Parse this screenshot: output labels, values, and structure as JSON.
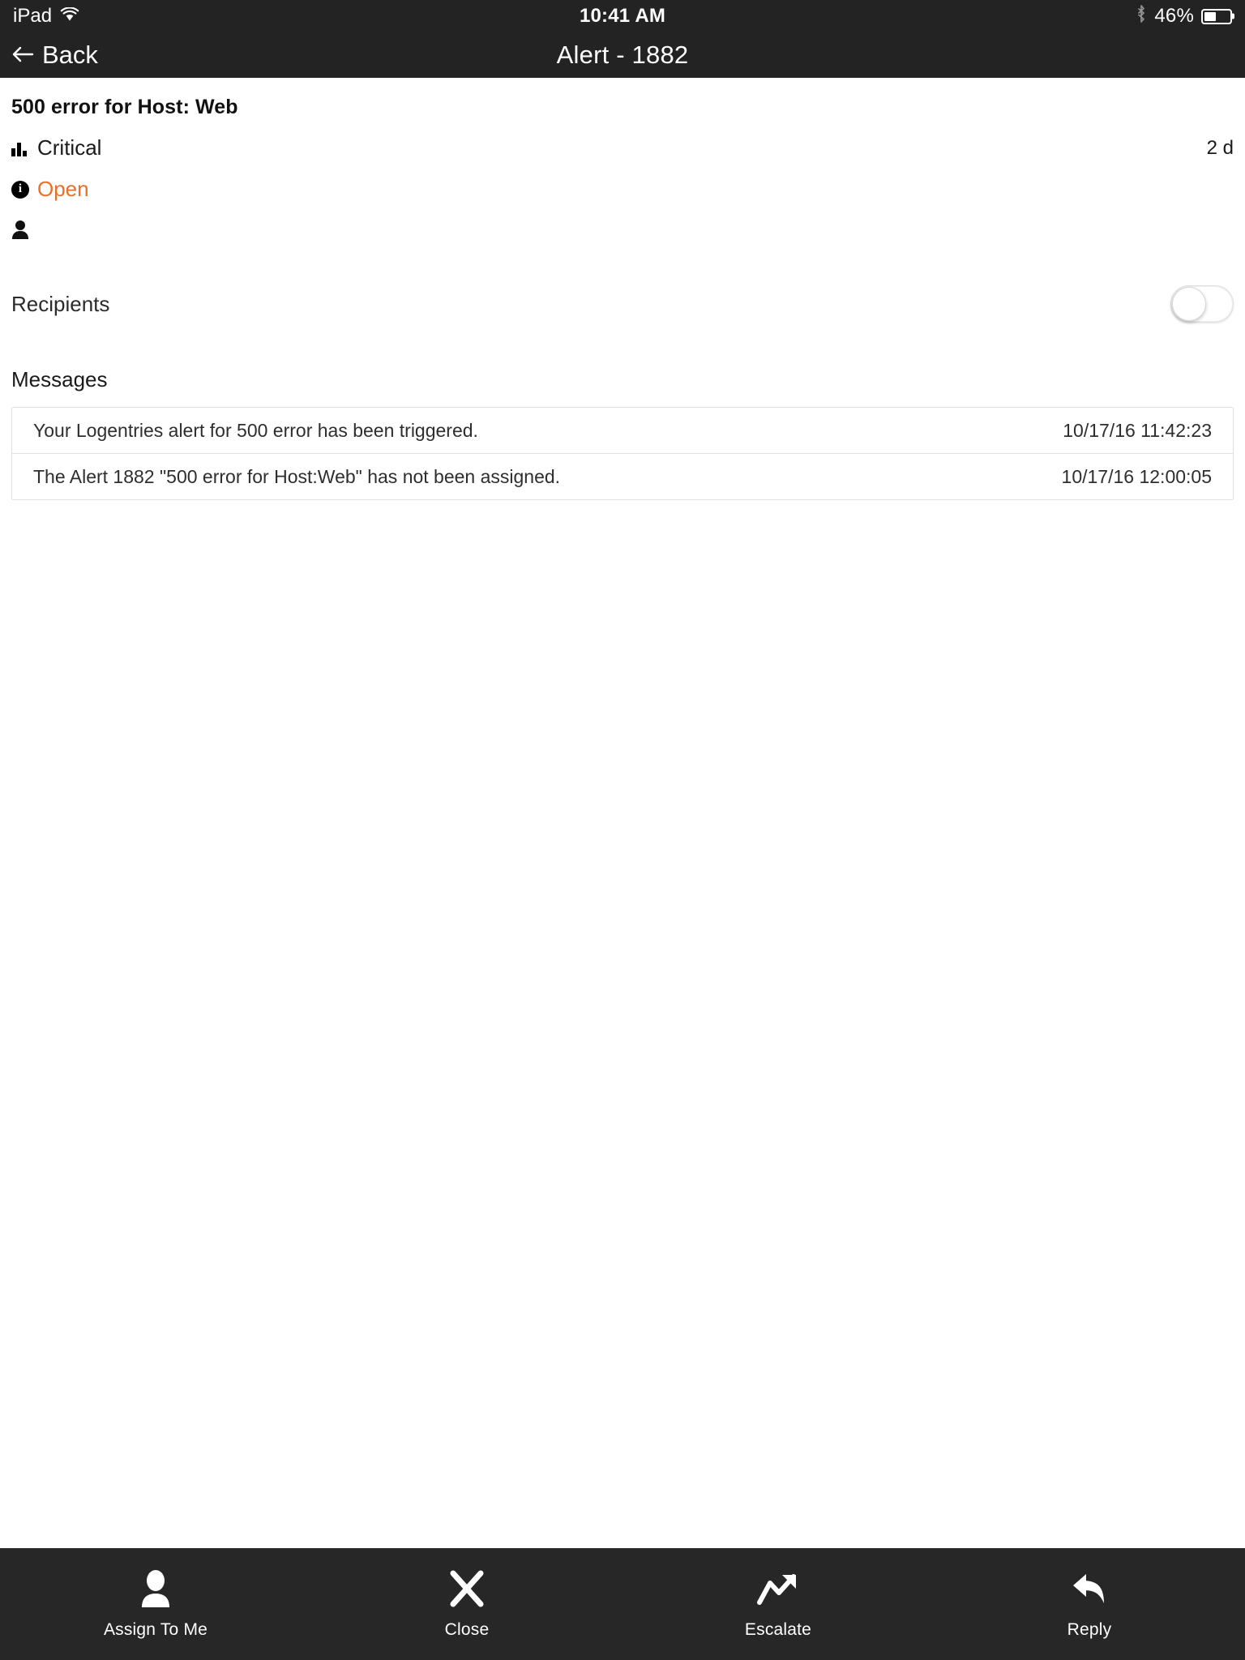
{
  "status_bar": {
    "device": "iPad",
    "wifi_icon": "wifi-icon",
    "time": "10:41 AM",
    "bluetooth_icon": "bluetooth-icon",
    "battery_percent": "46%",
    "battery_level": 46
  },
  "nav": {
    "back_icon": "back-arrow-icon",
    "back_label": "Back",
    "title": "Alert - 1882"
  },
  "alert": {
    "title": "500 error for Host: Web",
    "severity_icon": "severity-bars-icon",
    "severity": "Critical",
    "age": "2 d",
    "status_icon": "info-circle-icon",
    "status": "Open",
    "status_color": "#E8702A",
    "assignee_icon": "person-icon",
    "assignee": ""
  },
  "recipients": {
    "label": "Recipients",
    "toggle_on": false
  },
  "messages": {
    "heading": "Messages",
    "rows": [
      {
        "text": "Your Logentries alert for 500 error has been triggered.",
        "time": "10/17/16 11:42:23"
      },
      {
        "text": "The Alert 1882 \"500 error for Host:Web\" has not been assigned.",
        "time": "10/17/16 12:00:05"
      }
    ]
  },
  "toolbar": {
    "items": [
      {
        "label": "Assign To Me",
        "icon": "person-icon"
      },
      {
        "label": "Close",
        "icon": "close-x-icon"
      },
      {
        "label": "Escalate",
        "icon": "trending-up-icon"
      },
      {
        "label": "Reply",
        "icon": "reply-arrow-icon"
      }
    ]
  }
}
